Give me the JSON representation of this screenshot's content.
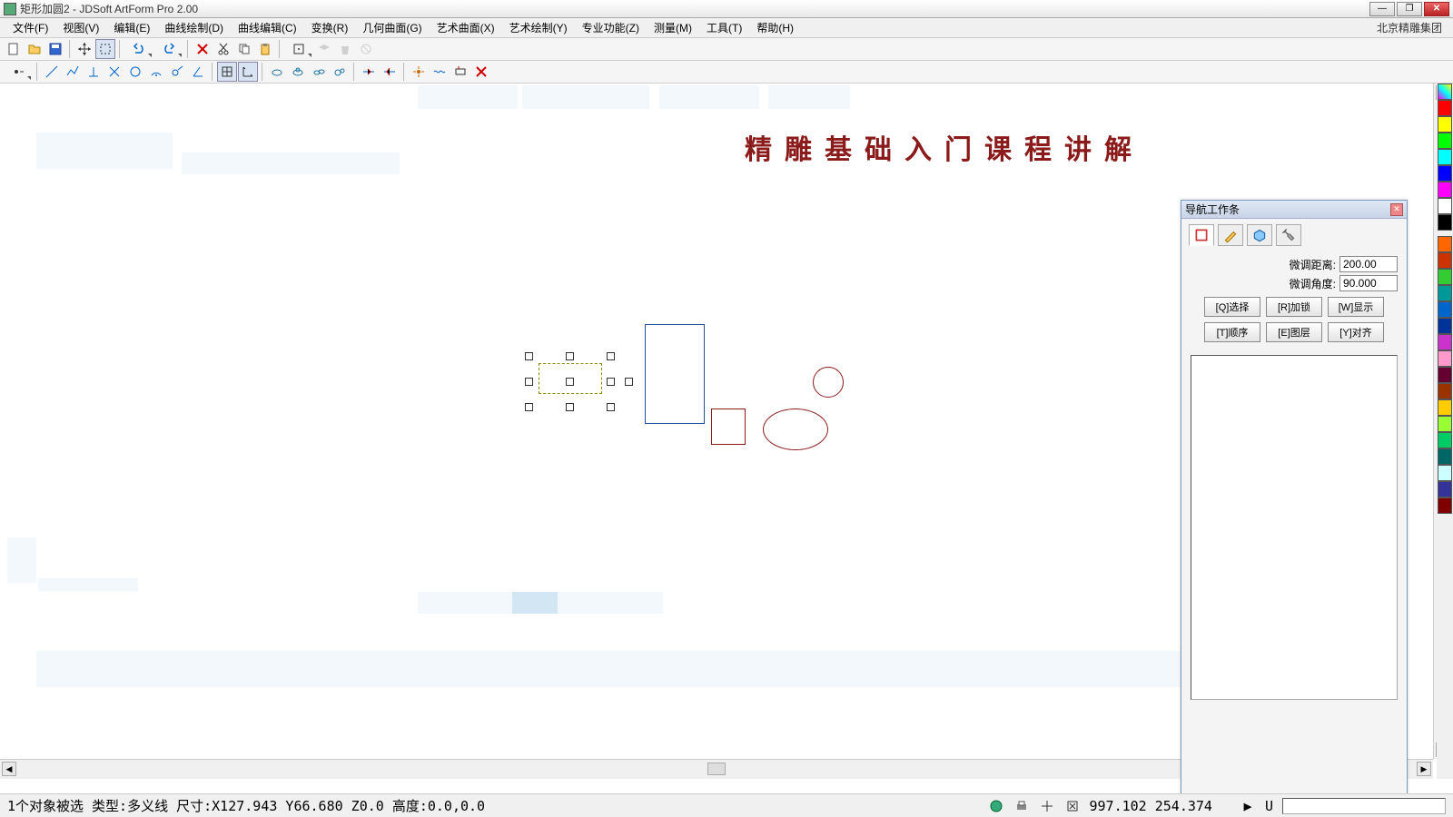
{
  "titlebar": {
    "text": "矩形加圆2 - JDSoft ArtForm Pro 2.00"
  },
  "menu": {
    "items": [
      "文件(F)",
      "视图(V)",
      "编辑(E)",
      "曲线绘制(D)",
      "曲线编辑(C)",
      "变换(R)",
      "几何曲面(G)",
      "艺术曲面(X)",
      "艺术绘制(Y)",
      "专业功能(Z)",
      "测量(M)",
      "工具(T)",
      "帮助(H)"
    ],
    "brand": "北京精雕集团"
  },
  "nav": {
    "title": "导航工作条",
    "dist_label": "微调距离:",
    "dist_value": "200.00",
    "angle_label": "微调角度:",
    "angle_value": "90.000",
    "buttons": [
      "[Q]选择",
      "[R]加锁",
      "[W]显示",
      "[T]顺序",
      "[E]图层",
      "[Y]对齐"
    ]
  },
  "canvas": {
    "watermark": "精雕基础入门课程讲解"
  },
  "status": {
    "left": "1个对象被选 类型:多义线 尺寸:X127.943 Y66.680 Z0.0 高度:0.0,0.0",
    "coords": "997.102 254.374",
    "u": "U"
  },
  "palette": [
    "#ff0000",
    "#ffff00",
    "#00ff00",
    "#00ffff",
    "#0000ff",
    "#ff00ff",
    "#ffffff",
    "#000000",
    "",
    "#ff6600",
    "#cc0000",
    "#00cc00",
    "#008080",
    "#0066cc",
    "#003399",
    "#cc00cc",
    "#ff99cc",
    "#660033",
    "#993300",
    "#ffcc00",
    "#99ff00",
    "#009933",
    "#006666",
    "#ccffff",
    "#333399",
    "#800000"
  ]
}
